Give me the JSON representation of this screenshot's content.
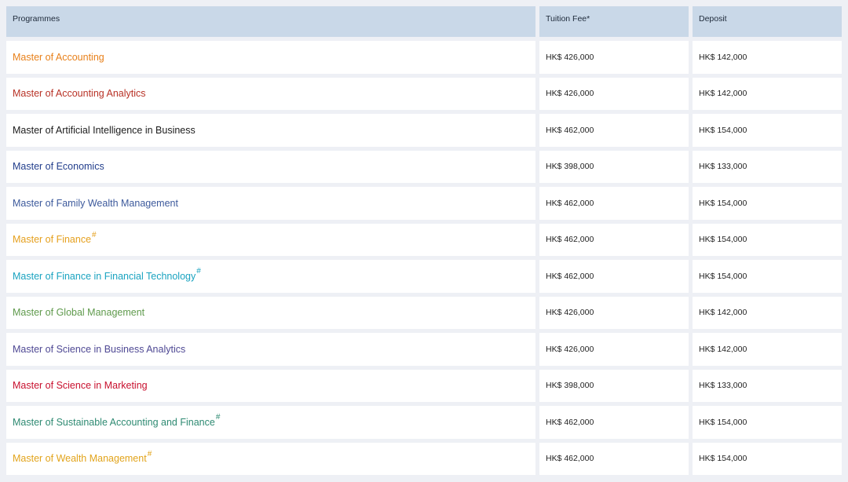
{
  "headers": {
    "programmes": "Programmes",
    "tuition": "Tuition Fee*",
    "deposit": "Deposit"
  },
  "rows": [
    {
      "programme": "Master of Accounting",
      "mark": "",
      "color": "#e8801a",
      "tuition": "HK$ 426,000",
      "deposit": "HK$ 142,000"
    },
    {
      "programme": "Master of Accounting Analytics",
      "mark": "",
      "color": "#b83226",
      "tuition": "HK$ 426,000",
      "deposit": "HK$ 142,000"
    },
    {
      "programme": "Master of Artificial Intelligence in Business",
      "mark": "",
      "color": "#1c1c1c",
      "tuition": "HK$ 462,000",
      "deposit": "HK$ 154,000"
    },
    {
      "programme": "Master of Economics",
      "mark": "",
      "color": "#223e8c",
      "tuition": "HK$ 398,000",
      "deposit": "HK$ 133,000"
    },
    {
      "programme": "Master of Family Wealth Management",
      "mark": "",
      "color": "#3d5a9c",
      "tuition": "HK$ 462,000",
      "deposit": "HK$ 154,000"
    },
    {
      "programme": "Master of Finance",
      "mark": "#",
      "color": "#e5a01e",
      "tuition": "HK$ 462,000",
      "deposit": "HK$ 154,000"
    },
    {
      "programme": "Master of Finance in Financial Technology",
      "mark": "#",
      "color": "#1aa3c0",
      "tuition": "HK$ 462,000",
      "deposit": "HK$ 154,000"
    },
    {
      "programme": "Master of Global Management",
      "mark": "",
      "color": "#5f9a4c",
      "tuition": "HK$ 426,000",
      "deposit": "HK$ 142,000"
    },
    {
      "programme": "Master of Science in Business Analytics",
      "mark": "",
      "color": "#4f4994",
      "tuition": "HK$ 426,000",
      "deposit": "HK$ 142,000"
    },
    {
      "programme": "Master of Science in Marketing",
      "mark": "",
      "color": "#c8102e",
      "tuition": "HK$ 398,000",
      "deposit": "HK$ 133,000"
    },
    {
      "programme": "Master of Sustainable Accounting and Finance",
      "mark": "#",
      "color": "#2e8a72",
      "tuition": "HK$ 462,000",
      "deposit": "HK$ 154,000"
    },
    {
      "programme": "Master of Wealth Management",
      "mark": "#",
      "color": "#e2a41c",
      "tuition": "HK$ 462,000",
      "deposit": "HK$ 154,000"
    }
  ]
}
